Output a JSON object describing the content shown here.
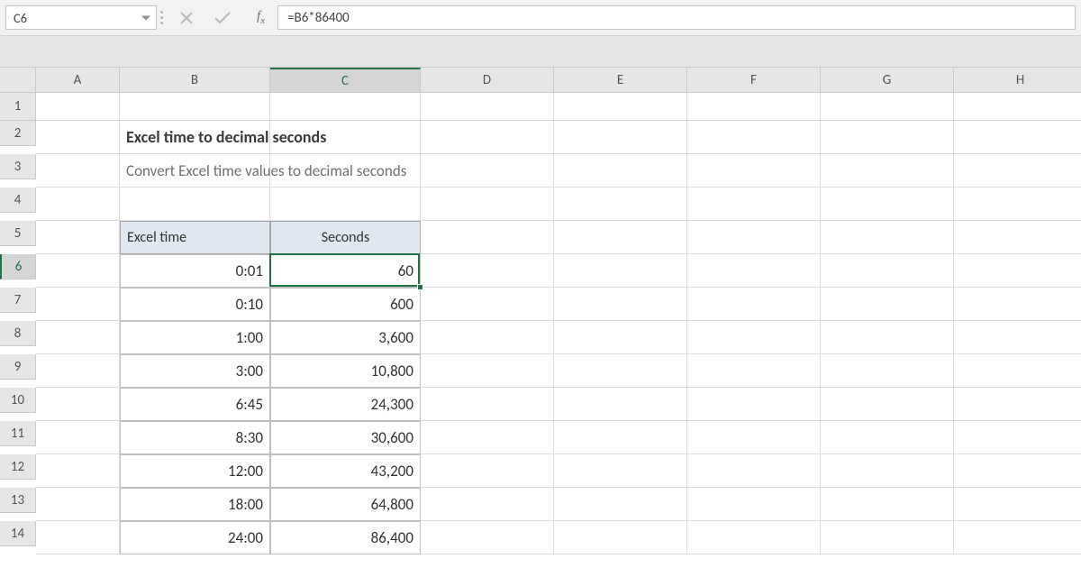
{
  "formula_bar": {
    "cell_ref": "C6",
    "formula": "=B6*86400"
  },
  "columns": [
    "A",
    "B",
    "C",
    "D",
    "E",
    "F",
    "G",
    "H"
  ],
  "row_headers": [
    "1",
    "2",
    "3",
    "4",
    "5",
    "6",
    "7",
    "8",
    "9",
    "10",
    "11",
    "12",
    "13",
    "14"
  ],
  "active": {
    "row": "6",
    "col": "C"
  },
  "content": {
    "title": "Excel time to decimal seconds",
    "subtitle": "Convert Excel time values to decimal seconds",
    "headers": {
      "col_b": "Excel time",
      "col_c": "Seconds"
    },
    "rows": [
      {
        "time": "0:01",
        "seconds": "60"
      },
      {
        "time": "0:10",
        "seconds": "600"
      },
      {
        "time": "1:00",
        "seconds": "3,600"
      },
      {
        "time": "3:00",
        "seconds": "10,800"
      },
      {
        "time": "6:45",
        "seconds": "24,300"
      },
      {
        "time": "8:30",
        "seconds": "30,600"
      },
      {
        "time": "12:00",
        "seconds": "43,200"
      },
      {
        "time": "18:00",
        "seconds": "64,800"
      },
      {
        "time": "24:00",
        "seconds": "86,400"
      }
    ]
  },
  "chart_data": {
    "type": "table",
    "title": "Excel time to decimal seconds",
    "columns": [
      "Excel time",
      "Seconds"
    ],
    "rows": [
      [
        "0:01",
        60
      ],
      [
        "0:10",
        600
      ],
      [
        "1:00",
        3600
      ],
      [
        "3:00",
        10800
      ],
      [
        "6:45",
        24300
      ],
      [
        "8:30",
        30600
      ],
      [
        "12:00",
        43200
      ],
      [
        "18:00",
        64800
      ],
      [
        "24:00",
        86400
      ]
    ]
  }
}
